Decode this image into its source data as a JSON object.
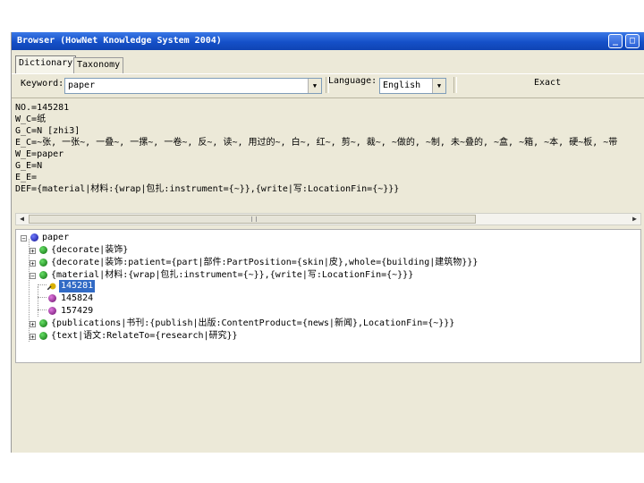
{
  "window": {
    "title": "Browser (HowNet Knowledge System 2004)",
    "minimize_glyph": "_",
    "maximize_glyph": "□"
  },
  "tabs": [
    {
      "label": "Dictionary",
      "active": true
    },
    {
      "label": "Taxonomy",
      "active": false
    }
  ],
  "search": {
    "keyword_label": "Keyword:",
    "keyword_value": "paper",
    "language_label": "Language:",
    "language_value": "English",
    "exact_label": "Exact"
  },
  "record": {
    "no": "NO.=145281",
    "w_c": "W_C=纸",
    "g_c": "G_C=N [zhi3]",
    "e_c": "E_C=~张, 一张~, 一叠~, 一摞~, 一卷~, 反~, 读~, 用过的~, 白~, 红~, 剪~, 裁~, ~做的, ~制, 未~叠的, ~盒, ~箱, ~本, 硬~板, ~带",
    "w_e": "W_E=paper",
    "g_e": "G_E=N",
    "e_e": "E_E=",
    "def": "DEF={material|材料:{wrap|包扎:instrument={~}},{write|写:LocationFin={~}}}"
  },
  "tree": {
    "root": "paper",
    "children": [
      {
        "text": "{decorate|装饰}"
      },
      {
        "text": "{decorate|装饰:patient={part|部件:PartPosition={skin|皮},whole={building|建筑物}}}"
      },
      {
        "text": "{material|材料:{wrap|包扎:instrument={~}},{write|写:LocationFin={~}}}"
      },
      {
        "text": "145281",
        "leaf": true,
        "selected": true
      },
      {
        "text": "145824",
        "leaf": true
      },
      {
        "text": "157429",
        "leaf": true
      },
      {
        "text": "{publications|书刊:{publish|出版:ContentProduct={news|新闻},LocationFin={~}}}"
      },
      {
        "text": "{text|语文:RelateTo={research|研究}}"
      }
    ]
  },
  "icons": {
    "expand": "+",
    "collapse": "−",
    "dropdown": "▼",
    "scroll_left": "◀",
    "scroll_right": "▶"
  }
}
